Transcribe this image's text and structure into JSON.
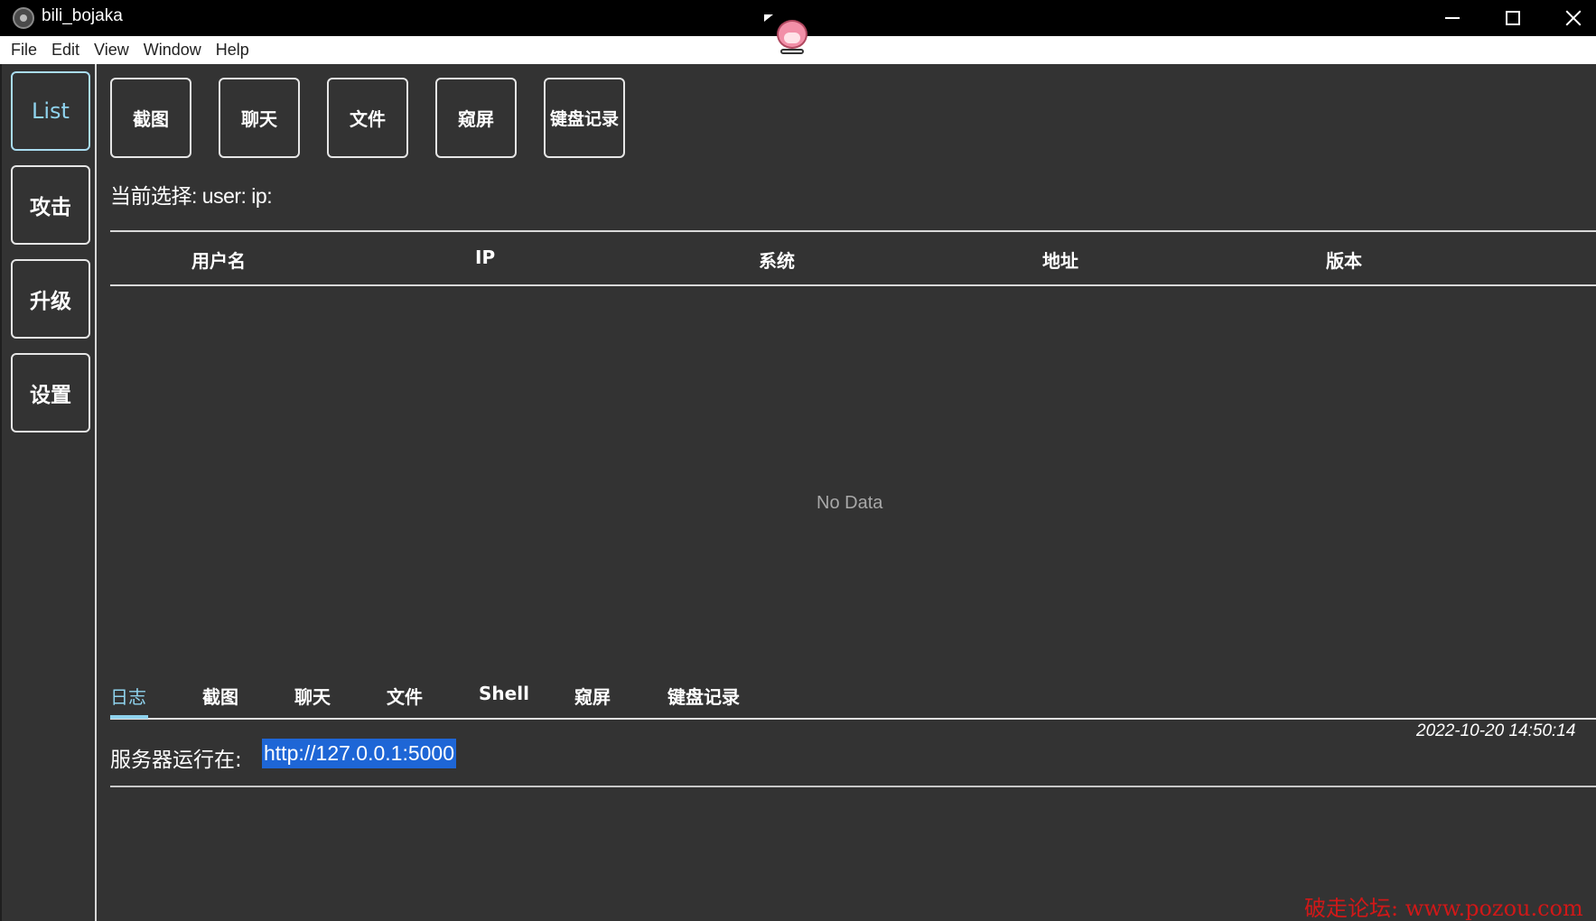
{
  "window": {
    "title": "bili_bojaka",
    "controls": [
      "minimize",
      "maximize",
      "close"
    ]
  },
  "menubar": {
    "items": [
      "File",
      "Edit",
      "View",
      "Window",
      "Help"
    ]
  },
  "sidebar": {
    "items": [
      {
        "label": "List",
        "active": true
      },
      {
        "label": "攻击",
        "active": false
      },
      {
        "label": "升级",
        "active": false
      },
      {
        "label": "设置",
        "active": false
      }
    ]
  },
  "toolbar": {
    "buttons": [
      "截图",
      "聊天",
      "文件",
      "窥屏",
      "键盘记录"
    ]
  },
  "selection": {
    "text": "当前选择: user: ip:"
  },
  "table": {
    "columns": [
      "用户名",
      "IP",
      "系统",
      "地址",
      "版本"
    ],
    "rows": [],
    "empty_text": "No Data"
  },
  "tabs": {
    "items": [
      "日志",
      "截图",
      "聊天",
      "文件",
      "Shell",
      "窥屏",
      "键盘记录"
    ],
    "active_index": 0
  },
  "log": {
    "entries": [
      {
        "time": "2022-10-20 14:50:14",
        "label": "服务器运行在:",
        "link": "http://127.0.0.1:5000"
      }
    ]
  },
  "watermark": {
    "text": "破走论坛: www.pozou.com"
  },
  "colors": {
    "background": "#333333",
    "accent": "#8fd3ee",
    "link_highlight": "#1e66d6",
    "watermark": "#d01818"
  }
}
